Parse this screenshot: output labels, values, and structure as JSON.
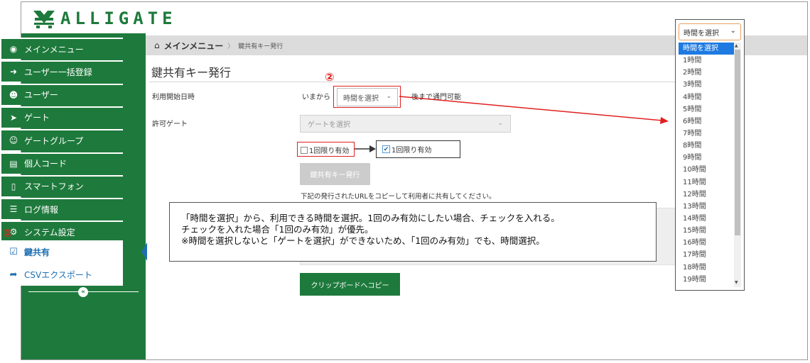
{
  "brand": {
    "logo_text": "ALLIGATE"
  },
  "sidebar": {
    "items": [
      {
        "label": "メインメニュー",
        "icon": "palette-icon"
      },
      {
        "label": "ユーザー一括登録",
        "icon": "share-icon"
      },
      {
        "label": "ユーザー",
        "icon": "user-icon"
      },
      {
        "label": "ゲート",
        "icon": "sign-in-icon"
      },
      {
        "label": "ゲートグループ",
        "icon": "users-icon"
      },
      {
        "label": "個人コード",
        "icon": "card-icon"
      },
      {
        "label": "スマートフォン",
        "icon": "mobile-icon"
      },
      {
        "label": "ログ情報",
        "icon": "list-icon"
      },
      {
        "label": "システム設定",
        "icon": "gear-icon"
      }
    ],
    "sub_items": [
      {
        "label": "鍵共有",
        "icon": "check-square-icon",
        "active": true
      },
      {
        "label": "CSVエクスポート",
        "icon": "share-arrow-icon",
        "active": false
      }
    ],
    "collapse_glyph": "«"
  },
  "breadcrumb": {
    "home": "メインメニュー",
    "sep": "〉",
    "current": "鍵共有キー発行"
  },
  "page": {
    "title": "鍵共有キー発行",
    "start_label": "利用開始日時",
    "from_now": "いまから",
    "time_select_value": "時間を選択",
    "until_text": "後まで通門可能",
    "gate_label": "許可ゲート",
    "gate_placeholder": "ゲートを選択",
    "once_label": "1回限り有効",
    "once_checked_label": "1回限り有効",
    "issue_button": "鍵共有キー発行",
    "copy_note": "下記の発行されたURLをコピーして利用者に共有してください。",
    "clipboard_button": "クリップボードへコピー"
  },
  "annotations": {
    "marker_1": "①",
    "marker_2": "②",
    "callout_lines": [
      "「時間を選択」から、利用できる時間を選択。1回のみ有効にしたい場合、チェックを入れる。",
      "チェックを入れた場合「1回のみ有効」が優先。",
      "※時間を選択しないと「ゲートを選択」ができないため、「1回のみ有効」でも、時間選択。"
    ],
    "arrow_color": "#e02020"
  },
  "dropdown": {
    "value": "時間を選択",
    "options": [
      "時間を選択",
      "1時間",
      "2時間",
      "3時間",
      "4時間",
      "5時間",
      "6時間",
      "7時間",
      "8時間",
      "9時間",
      "10時間",
      "11時間",
      "12時間",
      "13時間",
      "14時間",
      "15時間",
      "16時間",
      "17時間",
      "18時間",
      "19時間"
    ],
    "selected_index": 0
  },
  "colors": {
    "brand_green": "#1e7a3c",
    "link_blue": "#1e6fb0",
    "highlight_red": "#e02020",
    "select_blue": "#1e7ae0"
  }
}
